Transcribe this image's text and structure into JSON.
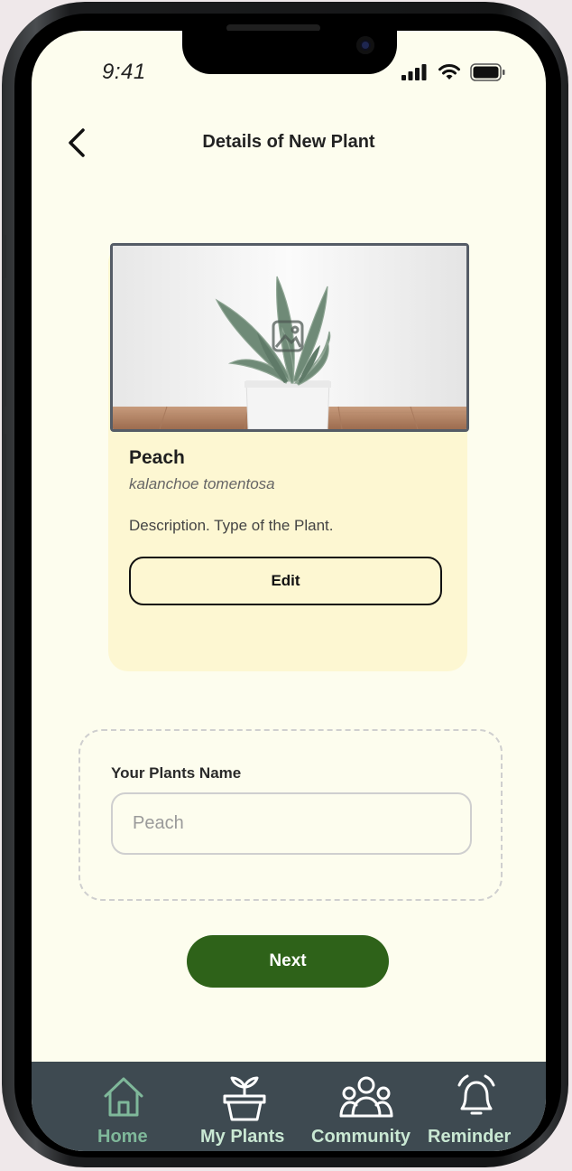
{
  "status_bar": {
    "time": "9:41"
  },
  "header": {
    "title": "Details of New Plant",
    "back_icon": "chevron-left-icon"
  },
  "plant_card": {
    "image_icon": "image-placeholder-icon",
    "name": "Peach",
    "species": "kalanchoe tomentosa",
    "description": "Description. Type of the Plant.",
    "edit_label": "Edit"
  },
  "name_form": {
    "label": "Your Plants Name",
    "placeholder": "Peach"
  },
  "next_label": "Next",
  "tab_bar": {
    "items": [
      {
        "label": "Home",
        "icon": "home-icon",
        "active": true
      },
      {
        "label": "My Plants",
        "icon": "plant-pot-icon",
        "active": false
      },
      {
        "label": "Community",
        "icon": "community-icon",
        "active": false
      },
      {
        "label": "Reminder",
        "icon": "alarm-icon",
        "active": false
      }
    ]
  },
  "colors": {
    "background": "#fdfdee",
    "card": "#fdf7d2",
    "primary": "#2e6219",
    "tab_bar": "#3e4a51",
    "tab_label": "#c9e8d3",
    "tab_active": "#7fb89a"
  }
}
